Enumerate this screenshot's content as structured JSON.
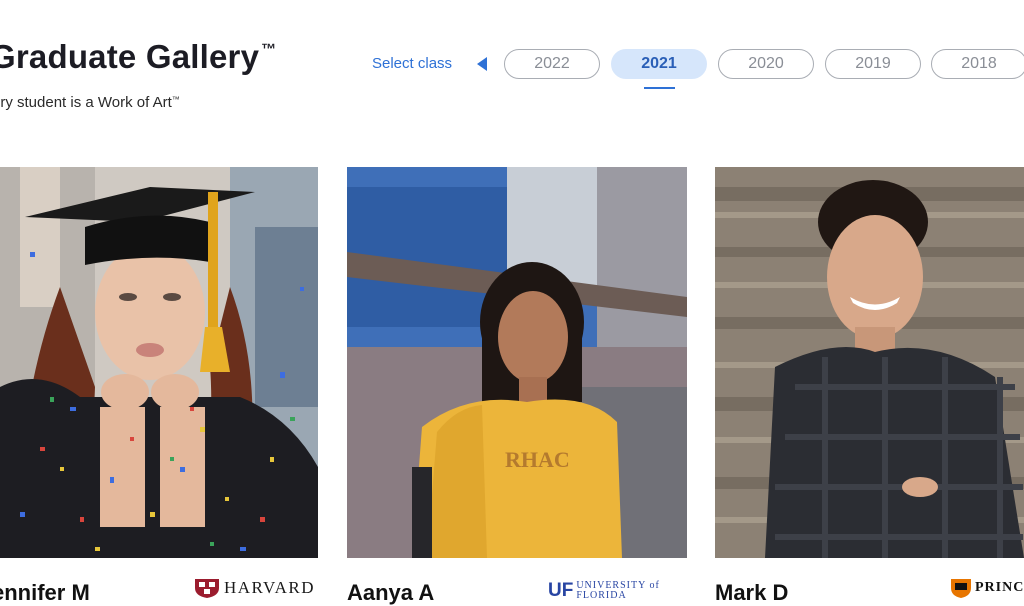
{
  "header": {
    "title": "Graduate Gallery",
    "title_mark": "™",
    "subtitle": "ery student is a Work of Art",
    "subtitle_mark": "™"
  },
  "class_selector": {
    "label": "Select class",
    "years": [
      "2022",
      "2021",
      "2020",
      "2019",
      "2018"
    ],
    "selected": "2021"
  },
  "students": [
    {
      "name": "ennifer M",
      "school": "HARVARD",
      "school_icon": "harvard-shield-icon"
    },
    {
      "name": "Aanya A",
      "school_mark": "UF",
      "school_line1": "UNIVERSITY of",
      "school_line2": "FLORIDA",
      "school_icon": "uf-logo"
    },
    {
      "name": "Mark D",
      "school": "PRINCE",
      "school_icon": "princeton-shield-icon"
    }
  ],
  "colors": {
    "accent": "#2e71d6",
    "active_pill": "#d6e6fb"
  }
}
